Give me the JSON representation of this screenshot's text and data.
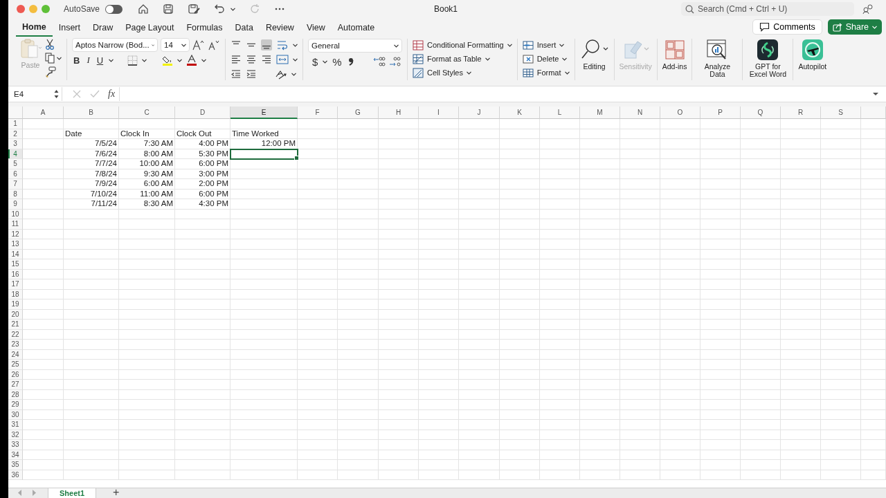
{
  "window": {
    "title": "Book1",
    "autosave_label": "AutoSave",
    "autosave_on": false,
    "search_placeholder": "Search (Cmd + Ctrl + U)"
  },
  "tabs": [
    {
      "label": "Home",
      "selected": true
    },
    {
      "label": "Insert",
      "selected": false
    },
    {
      "label": "Draw",
      "selected": false
    },
    {
      "label": "Page Layout",
      "selected": false
    },
    {
      "label": "Formulas",
      "selected": false
    },
    {
      "label": "Data",
      "selected": false
    },
    {
      "label": "Review",
      "selected": false
    },
    {
      "label": "View",
      "selected": false
    },
    {
      "label": "Automate",
      "selected": false
    }
  ],
  "header_buttons": {
    "comments": "Comments",
    "share": "Share"
  },
  "ribbon": {
    "paste_label": "Paste",
    "font_name": "Aptos Narrow (Bod...",
    "font_size": "14",
    "format_buttons": [
      "B",
      "I",
      "U"
    ],
    "number_format": "General",
    "currency": "$",
    "percent": "%",
    "styles": [
      "Conditional Formatting",
      "Format as Table",
      "Cell Styles"
    ],
    "cells": [
      "Insert",
      "Delete",
      "Format"
    ],
    "big_buttons": [
      {
        "label": "Editing",
        "kind": "editing",
        "disabled": false
      },
      {
        "label": "Sensitivity",
        "kind": "sensitivity",
        "disabled": true
      },
      {
        "label": "Add-ins",
        "kind": "addins",
        "disabled": false
      },
      {
        "label": "Analyze Data",
        "kind": "analyze",
        "disabled": false
      },
      {
        "label": "GPT for Excel Word",
        "kind": "gpt",
        "disabled": false
      },
      {
        "label": "Autopilot",
        "kind": "autopilot",
        "disabled": false
      }
    ]
  },
  "formula_bar": {
    "name_box": "E4",
    "fx": "fx"
  },
  "columns": [
    {
      "label": "A",
      "selected": false
    },
    {
      "label": "B",
      "selected": false
    },
    {
      "label": "C",
      "selected": false
    },
    {
      "label": "D",
      "selected": false
    },
    {
      "label": "E",
      "selected": true
    },
    {
      "label": "F",
      "selected": false
    },
    {
      "label": "G",
      "selected": false
    },
    {
      "label": "H",
      "selected": false
    },
    {
      "label": "I",
      "selected": false
    },
    {
      "label": "J",
      "selected": false
    },
    {
      "label": "K",
      "selected": false
    },
    {
      "label": "L",
      "selected": false
    },
    {
      "label": "M",
      "selected": false
    },
    {
      "label": "N",
      "selected": false
    },
    {
      "label": "O",
      "selected": false
    },
    {
      "label": "P",
      "selected": false
    },
    {
      "label": "Q",
      "selected": false
    },
    {
      "label": "R",
      "selected": false
    },
    {
      "label": "S",
      "selected": false
    }
  ],
  "rows": [
    {
      "number": "1",
      "selected": false
    },
    {
      "number": "2",
      "selected": false,
      "kind": "header",
      "values": [
        "Date",
        "Clock In",
        "Clock Out",
        "Time Worked"
      ]
    },
    {
      "number": "3",
      "selected": false,
      "kind": "value",
      "values": [
        "7/5/24",
        "7:30 AM",
        "4:00 PM",
        "12:00 PM"
      ]
    },
    {
      "number": "4",
      "selected": true,
      "kind": "value",
      "values": [
        "7/6/24",
        "8:00 AM",
        "5:30 PM"
      ]
    },
    {
      "number": "5",
      "selected": false,
      "kind": "value",
      "values": [
        "7/7/24",
        "10:00 AM",
        "6:00 PM"
      ]
    },
    {
      "number": "6",
      "selected": false,
      "kind": "value",
      "values": [
        "7/8/24",
        "9:30 AM",
        "3:00 PM"
      ]
    },
    {
      "number": "7",
      "selected": false,
      "kind": "value",
      "values": [
        "7/9/24",
        "6:00 AM",
        "2:00 PM"
      ]
    },
    {
      "number": "8",
      "selected": false,
      "kind": "value",
      "values": [
        "7/10/24",
        "11:00 AM",
        "6:00 PM"
      ]
    },
    {
      "number": "9",
      "selected": false,
      "kind": "value",
      "values": [
        "7/11/24",
        "8:30 AM",
        "4:30 PM"
      ]
    },
    {
      "number": "10",
      "selected": false
    },
    {
      "number": "11",
      "selected": false
    },
    {
      "number": "12",
      "selected": false
    },
    {
      "number": "13",
      "selected": false
    },
    {
      "number": "14",
      "selected": false
    },
    {
      "number": "15",
      "selected": false
    },
    {
      "number": "16",
      "selected": false
    },
    {
      "number": "17",
      "selected": false
    },
    {
      "number": "18",
      "selected": false
    },
    {
      "number": "19",
      "selected": false
    },
    {
      "number": "20",
      "selected": false
    },
    {
      "number": "21",
      "selected": false
    },
    {
      "number": "22",
      "selected": false
    },
    {
      "number": "23",
      "selected": false
    },
    {
      "number": "24",
      "selected": false
    },
    {
      "number": "25",
      "selected": false
    },
    {
      "number": "26",
      "selected": false
    },
    {
      "number": "27",
      "selected": false
    },
    {
      "number": "28",
      "selected": false
    },
    {
      "number": "29",
      "selected": false
    },
    {
      "number": "30",
      "selected": false
    },
    {
      "number": "31",
      "selected": false
    },
    {
      "number": "32",
      "selected": false
    },
    {
      "number": "33",
      "selected": false
    },
    {
      "number": "34",
      "selected": false
    },
    {
      "number": "35",
      "selected": false
    },
    {
      "number": "36",
      "selected": false
    }
  ],
  "sheet_tabs": [
    {
      "label": "Sheet1",
      "selected": true
    }
  ],
  "add_sheet": "+"
}
